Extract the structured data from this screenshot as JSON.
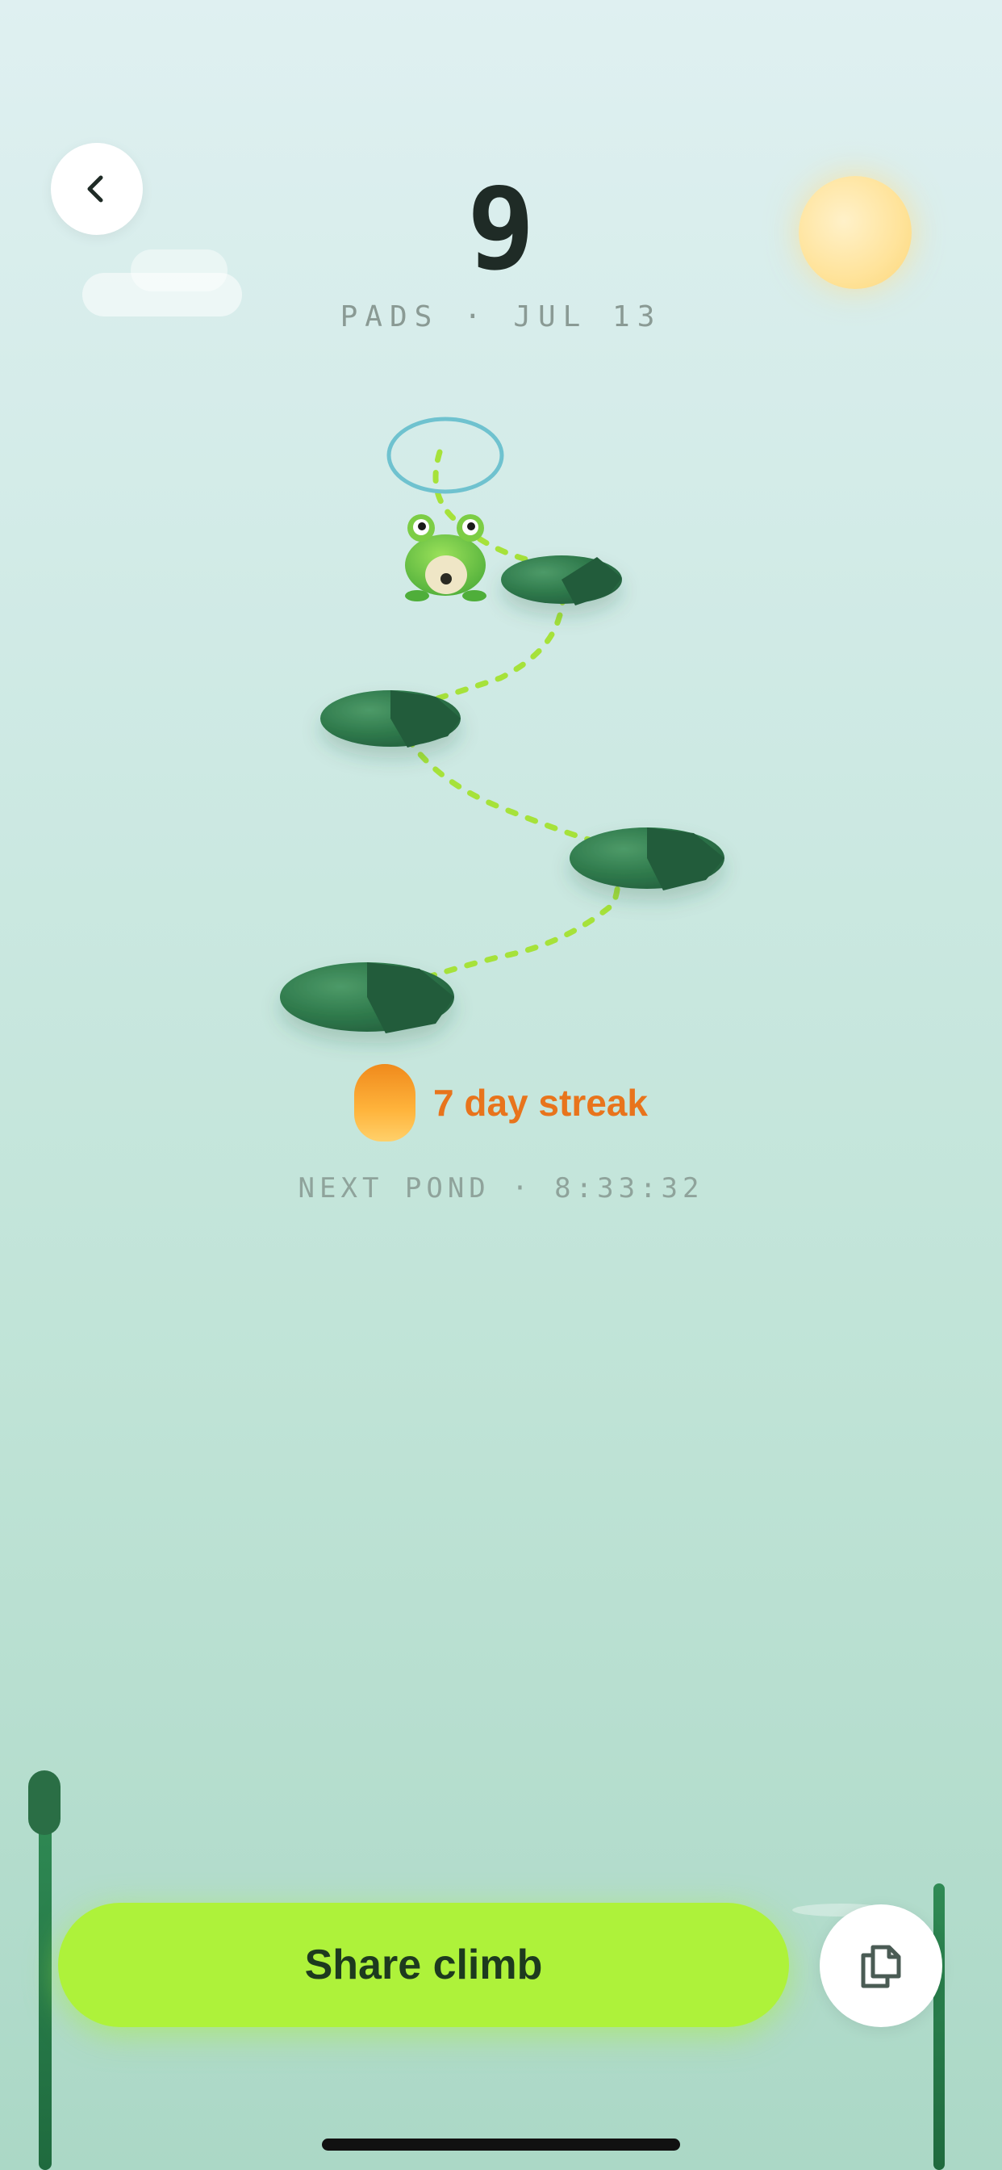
{
  "header": {
    "score": "9",
    "caption": "PADS · JUL 13"
  },
  "icons": {
    "back": "chevron-left-icon",
    "copy": "copy-icon",
    "streak": "flame-icon",
    "character": "frog"
  },
  "streak": {
    "label": "7 day streak"
  },
  "next_pond": {
    "label": "NEXT POND · 8:33:32"
  },
  "actions": {
    "share_label": "Share climb"
  },
  "colors": {
    "accent": "#aef23a",
    "streak": "#e8741c",
    "pad": "#2a6e45",
    "path": "#a6e23a",
    "target_ring": "#6fc2cf"
  }
}
